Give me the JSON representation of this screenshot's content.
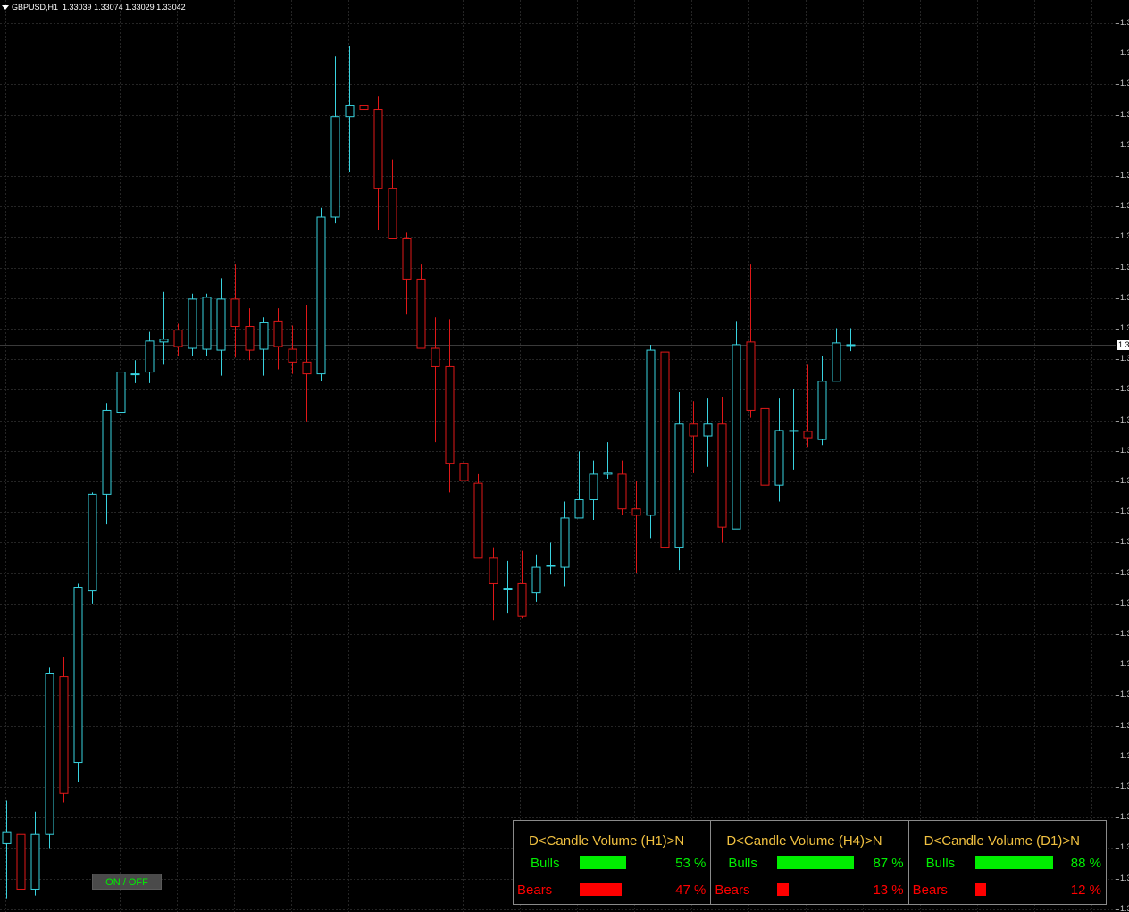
{
  "header": {
    "symbol": "GBPUSD,H1",
    "ohlc": "1.33039 1.33074 1.33029 1.33042"
  },
  "colors": {
    "bull": "#39d3e0",
    "bear": "#e01818",
    "grid": "#252525",
    "background": "#000000"
  },
  "axis": {
    "labels": [
      "1.3",
      "1.3",
      "1.3",
      "1.3",
      "1.3",
      "1.3",
      "1.3",
      "1.3",
      "1.3",
      "1.3",
      "1.3",
      "1.3",
      "1.3",
      "1.3",
      "1.3",
      "1.3",
      "1.3",
      "1.3",
      "1.3",
      "1.3",
      "1.3",
      "1.3",
      "1.3",
      "1.3",
      "1.3",
      "1.3",
      "1.3",
      "1.3",
      "1.3",
      "1.3"
    ],
    "current": "1.3"
  },
  "onoff_label": "ON / OFF",
  "panel": [
    {
      "title": "D<Candle Volume (H1)>N",
      "bulls_label": "Bulls",
      "bears_label": "Bears",
      "bulls_pct": "53 %",
      "bears_pct": "47 %",
      "bulls_value": 53,
      "bears_value": 47
    },
    {
      "title": "D<Candle Volume (H4)>N",
      "bulls_label": "Bulls",
      "bears_label": "Bears",
      "bulls_pct": "87 %",
      "bears_pct": "13 %",
      "bulls_value": 87,
      "bears_value": 13
    },
    {
      "title": "D<Candle Volume (D1)>N",
      "bulls_label": "Bulls",
      "bears_label": "Bears",
      "bulls_pct": "88 %",
      "bears_pct": "12 %",
      "bulls_value": 88,
      "bears_value": 12
    }
  ],
  "chart_data": {
    "type": "candlestick",
    "title": "GBPUSD,H1",
    "ylim": [
      0,
      1000
    ],
    "candles": [
      [
        925,
        912,
        878,
        985
      ],
      [
        915,
        975,
        888,
        985
      ],
      [
        975,
        915,
        890,
        982
      ],
      [
        915,
        738,
        732,
        930
      ],
      [
        742,
        870,
        720,
        880
      ],
      [
        836,
        644,
        640,
        858
      ],
      [
        648,
        542,
        540,
        662
      ],
      [
        542,
        450,
        442,
        575
      ],
      [
        452,
        408,
        384,
        480
      ],
      [
        410,
        410,
        395,
        420
      ],
      [
        408,
        374,
        364,
        420
      ],
      [
        375,
        372,
        320,
        400
      ],
      [
        362,
        380,
        355,
        390
      ],
      [
        382,
        328,
        322,
        390
      ],
      [
        383,
        326,
        322,
        390
      ],
      [
        384,
        328,
        305,
        412
      ],
      [
        328,
        358,
        290,
        392
      ],
      [
        358,
        384,
        338,
        395
      ],
      [
        383,
        354,
        348,
        412
      ],
      [
        352,
        380,
        338,
        405
      ],
      [
        383,
        397,
        357,
        410
      ],
      [
        397,
        410,
        335,
        462
      ],
      [
        410,
        238,
        228,
        418
      ],
      [
        238,
        128,
        62,
        245
      ],
      [
        128,
        116,
        50,
        188
      ],
      [
        116,
        120,
        98,
        212
      ],
      [
        120,
        207,
        106,
        252
      ],
      [
        207,
        262,
        175,
        262
      ],
      [
        262,
        306,
        255,
        345
      ],
      [
        306,
        382,
        290,
        382
      ],
      [
        382,
        402,
        348,
        485
      ],
      [
        402,
        508,
        350,
        540
      ],
      [
        508,
        527,
        478,
        578
      ],
      [
        530,
        612,
        520,
        612
      ],
      [
        612,
        640,
        600,
        680
      ],
      [
        645,
        645,
        615,
        672
      ],
      [
        640,
        676,
        604,
        678
      ],
      [
        650,
        622,
        608,
        660
      ],
      [
        620,
        620,
        595,
        630
      ],
      [
        622,
        568,
        550,
        643
      ],
      [
        568,
        548,
        495,
        565
      ],
      [
        548,
        520,
        505,
        570
      ],
      [
        520,
        518,
        485,
        525
      ],
      [
        520,
        558,
        505,
        565
      ],
      [
        558,
        565,
        527,
        628
      ],
      [
        565,
        384,
        378,
        590
      ],
      [
        386,
        600,
        378,
        600
      ],
      [
        600,
        465,
        430,
        625
      ],
      [
        465,
        478,
        440,
        518
      ],
      [
        478,
        465,
        437,
        512
      ],
      [
        465,
        578,
        435,
        595
      ],
      [
        580,
        378,
        352,
        580
      ],
      [
        375,
        450,
        290,
        458
      ],
      [
        448,
        532,
        382,
        620
      ],
      [
        532,
        472,
        437,
        550
      ],
      [
        472,
        472,
        427,
        515
      ],
      [
        473,
        480,
        400,
        490
      ],
      [
        482,
        418,
        390,
        488
      ],
      [
        418,
        376,
        360,
        418
      ],
      [
        378,
        378,
        360,
        385
      ]
    ]
  }
}
